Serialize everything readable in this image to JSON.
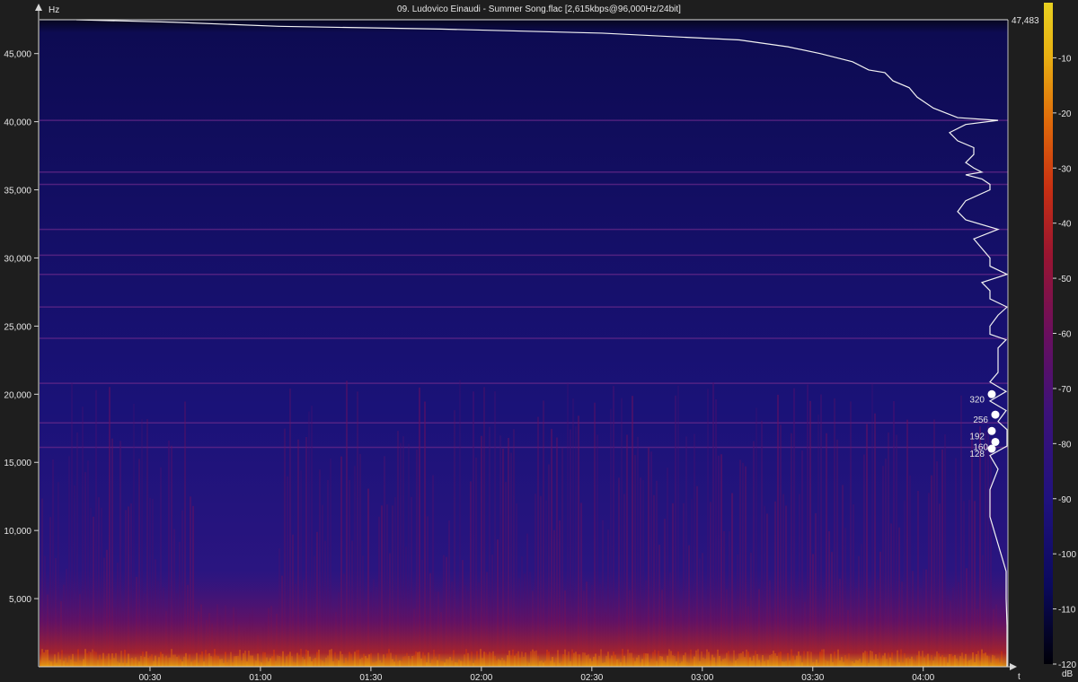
{
  "window": {
    "title": "09. Ludovico Einaudi - Summer Song.flac [2,615kbps@96,000Hz/24bit]"
  },
  "y_axis": {
    "unit_label": "Hz",
    "ticks": [
      "5,000",
      "10,000",
      "15,000",
      "20,000",
      "25,000",
      "30,000",
      "35,000",
      "40,000",
      "45,000"
    ],
    "tick_values": [
      5000,
      10000,
      15000,
      20000,
      25000,
      30000,
      35000,
      40000,
      45000
    ],
    "max_label": "47,483",
    "max_value": 47483,
    "range": [
      0,
      47483
    ]
  },
  "x_axis": {
    "unit_label": "t",
    "ticks": [
      "00:30",
      "01:00",
      "01:30",
      "02:00",
      "02:30",
      "03:00",
      "03:30",
      "04:00"
    ],
    "tick_seconds": [
      30,
      60,
      90,
      120,
      150,
      180,
      210,
      240
    ],
    "range_seconds": [
      0,
      263
    ]
  },
  "colorbar": {
    "unit_label": "dB",
    "ticks": [
      "-10",
      "-20",
      "-30",
      "-40",
      "-50",
      "-60",
      "-70",
      "-80",
      "-90",
      "-100",
      "-110",
      "-120"
    ],
    "tick_values": [
      -10,
      -20,
      -30,
      -40,
      -50,
      -60,
      -70,
      -80,
      -90,
      -100,
      -110,
      -120
    ],
    "range": [
      -120,
      0
    ],
    "colors": [
      "#000008",
      "#0b0a5e",
      "#20127e",
      "#3c127a",
      "#6a0f5e",
      "#9a1530",
      "#c83012",
      "#e06a0a",
      "#e8b012",
      "#e8d020"
    ]
  },
  "bitrate_markers": [
    {
      "label": "320",
      "freq": 20000
    },
    {
      "label": "256",
      "freq": 18500
    },
    {
      "label": "192",
      "freq": 17300
    },
    {
      "label": "160",
      "freq": 16500
    },
    {
      "label": "128",
      "freq": 16000
    }
  ],
  "spectrum_profile": {
    "note": "",
    "points": [
      [
        47483,
        0
      ],
      [
        47300,
        12
      ],
      [
        47000,
        25
      ],
      [
        46800,
        45
      ],
      [
        46500,
        65
      ],
      [
        46000,
        82
      ],
      [
        45500,
        88
      ],
      [
        45000,
        92
      ],
      [
        44400,
        96
      ],
      [
        43800,
        98
      ],
      [
        43600,
        100
      ],
      [
        43000,
        101
      ],
      [
        42500,
        103
      ],
      [
        41800,
        104
      ],
      [
        41000,
        106
      ],
      [
        40300,
        109
      ],
      [
        40100,
        114
      ],
      [
        39800,
        110
      ],
      [
        39200,
        108
      ],
      [
        38600,
        109
      ],
      [
        38100,
        111
      ],
      [
        37600,
        111
      ],
      [
        37000,
        110
      ],
      [
        36600,
        111
      ],
      [
        36300,
        112
      ],
      [
        36100,
        110
      ],
      [
        35800,
        112
      ],
      [
        35400,
        113
      ],
      [
        35000,
        113
      ],
      [
        34200,
        110
      ],
      [
        33400,
        109
      ],
      [
        32800,
        110
      ],
      [
        32100,
        114
      ],
      [
        31400,
        111
      ],
      [
        30700,
        112
      ],
      [
        30000,
        113
      ],
      [
        29400,
        113
      ],
      [
        28800,
        116
      ],
      [
        28200,
        112
      ],
      [
        27600,
        113
      ],
      [
        27000,
        113
      ],
      [
        26400,
        116
      ],
      [
        25800,
        114
      ],
      [
        25000,
        113
      ],
      [
        24400,
        113
      ],
      [
        24000,
        115
      ],
      [
        23400,
        114
      ],
      [
        22200,
        114
      ],
      [
        21600,
        114
      ],
      [
        20900,
        113
      ],
      [
        20200,
        115
      ],
      [
        19500,
        113
      ],
      [
        18800,
        115
      ],
      [
        18000,
        114
      ],
      [
        17400,
        117
      ],
      [
        16800,
        116
      ],
      [
        16200,
        116
      ],
      [
        15500,
        113
      ],
      [
        14500,
        114
      ],
      [
        13000,
        113
      ],
      [
        11000,
        113
      ],
      [
        9000,
        114
      ],
      [
        7000,
        115
      ],
      [
        5000,
        115
      ],
      [
        3000,
        116
      ],
      [
        1500,
        117
      ],
      [
        0,
        118
      ]
    ]
  },
  "horizontal_lines_hz": [
    40100,
    36300,
    35400,
    32100,
    30200,
    28800,
    26400,
    24100,
    20800,
    17900,
    16100
  ]
}
